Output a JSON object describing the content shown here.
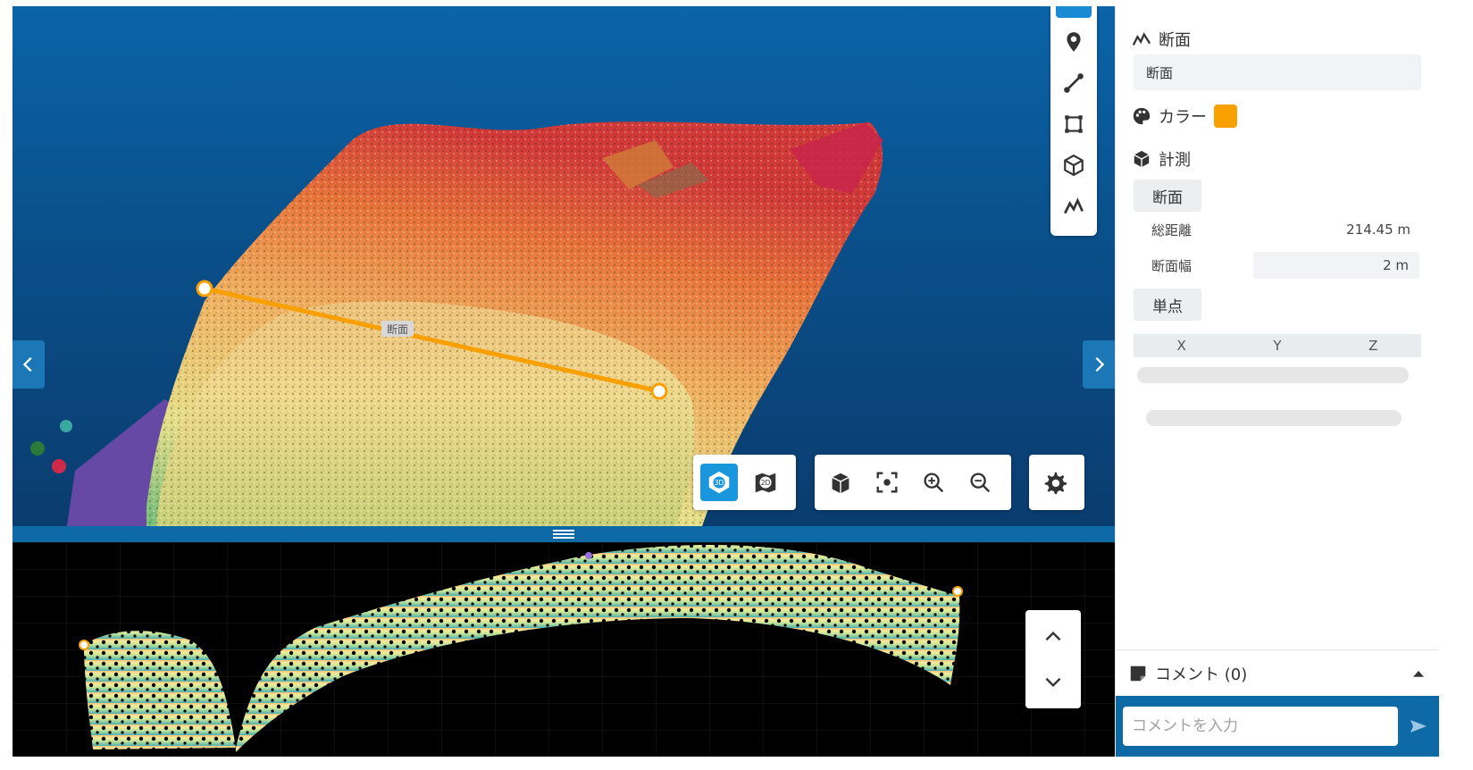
{
  "viewer": {
    "section_line_label": "断面"
  },
  "tools": {
    "rail": [
      "pin-icon",
      "line-tool-icon",
      "area-tool-icon",
      "volume-tool-icon",
      "section-tool-icon"
    ],
    "mode_3d": "3D",
    "mode_2d": "2D"
  },
  "panel": {
    "section_title": "断面",
    "name_value": "断面",
    "color_label": "カラー",
    "color_value": "#f7a000",
    "measure_label": "計測",
    "section_chip": "断面",
    "total_distance_label": "総距離",
    "total_distance_value": "214.45 m",
    "section_width_label": "断面幅",
    "section_width_value": "2 m",
    "single_point_chip": "単点",
    "coord_headers": [
      "X",
      "Y",
      "Z"
    ]
  },
  "comments": {
    "title": "コメント (0)",
    "input_placeholder": "コメントを入力"
  },
  "colors": {
    "accent": "#1a96dc",
    "section_line": "#f7a000",
    "panel_blue": "#0e6aa6"
  }
}
